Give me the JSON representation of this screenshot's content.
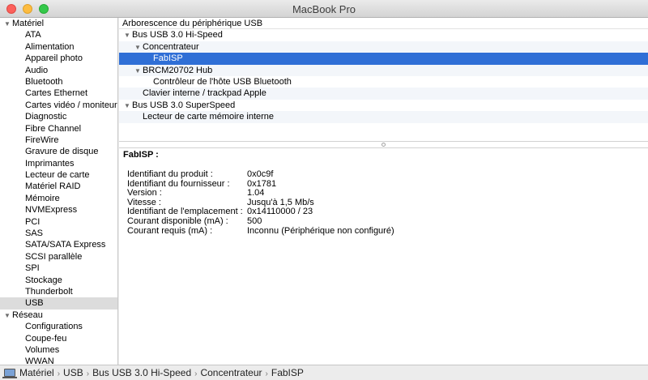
{
  "window": {
    "title": "MacBook Pro"
  },
  "sidebar": {
    "groups": [
      {
        "label": "Matériel",
        "items": [
          "ATA",
          "Alimentation",
          "Appareil photo",
          "Audio",
          "Bluetooth",
          "Cartes Ethernet",
          "Cartes vidéo / moniteurs",
          "Diagnostic",
          "Fibre Channel",
          "FireWire",
          "Gravure de disque",
          "Imprimantes",
          "Lecteur de carte",
          "Matériel RAID",
          "Mémoire",
          "NVMExpress",
          "PCI",
          "SAS",
          "SATA/SATA Express",
          "SCSI parallèle",
          "SPI",
          "Stockage",
          "Thunderbolt",
          "USB"
        ]
      },
      {
        "label": "Réseau",
        "items": [
          "Configurations",
          "Coupe-feu",
          "Volumes",
          "WWAN"
        ]
      }
    ],
    "selected": "USB"
  },
  "tree": {
    "header": "Arborescence du périphérique USB",
    "rows": [
      {
        "label": "Bus USB 3.0 Hi-Speed",
        "indent": 0,
        "expander": true
      },
      {
        "label": "Concentrateur",
        "indent": 1,
        "expander": true
      },
      {
        "label": "FabISP",
        "indent": 2,
        "expander": false,
        "selected": true
      },
      {
        "label": "BRCM20702 Hub",
        "indent": 1,
        "expander": true
      },
      {
        "label": "Contrôleur de l'hôte USB Bluetooth",
        "indent": 2,
        "expander": false
      },
      {
        "label": "Clavier interne / trackpad Apple",
        "indent": 1,
        "expander": false
      },
      {
        "label": "Bus USB 3.0 SuperSpeed",
        "indent": 0,
        "expander": true
      },
      {
        "label": "Lecteur de carte mémoire interne",
        "indent": 1,
        "expander": false
      },
      {
        "label": "",
        "indent": 0,
        "expander": false
      }
    ]
  },
  "detail": {
    "title": "FabISP :",
    "properties": [
      {
        "name": "Identifiant du produit :",
        "value": "0x0c9f"
      },
      {
        "name": "Identifiant du fournisseur :",
        "value": "0x1781"
      },
      {
        "name": "Version :",
        "value": "1.04"
      },
      {
        "name": "Vitesse :",
        "value": "Jusqu'à 1,5 Mb/s"
      },
      {
        "name": "Identifiant de l'emplacement :",
        "value": "0x14110000 / 23"
      },
      {
        "name": "Courant disponible (mA) :",
        "value": "500"
      },
      {
        "name": "Courant requis (mA) :",
        "value": "Inconnu (Périphérique non configuré)"
      }
    ]
  },
  "pathbar": {
    "icon": "laptop-icon",
    "crumbs": [
      "Matériel",
      "USB",
      "Bus USB 3.0 Hi-Speed",
      "Concentrateur",
      "FabISP"
    ]
  }
}
